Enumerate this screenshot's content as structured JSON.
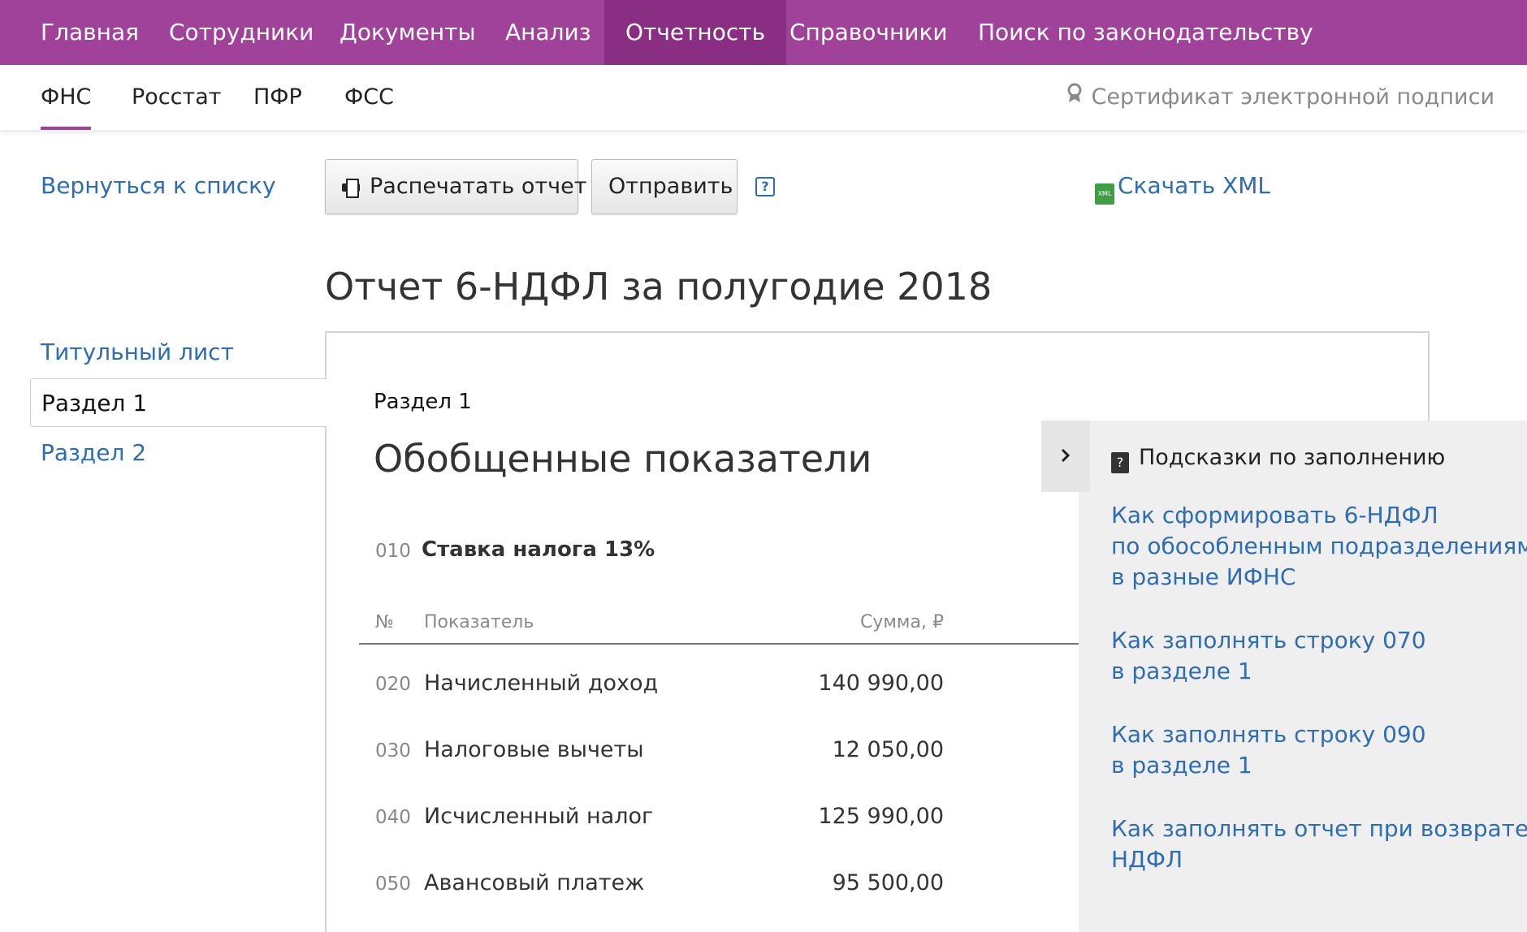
{
  "topnav": {
    "items": [
      "Главная",
      "Сотрудники",
      "Документы",
      "Анализ",
      "Отчетность",
      "Справочники",
      "Поиск по законодательству"
    ],
    "active": "Отчетность"
  },
  "subnav": {
    "items": [
      "ФНС",
      "Росстат",
      "ПФР",
      "ФСС"
    ],
    "active": "ФНС",
    "certificate": "Сертификат электронной подписи"
  },
  "toolbar": {
    "back": "Вернуться к списку",
    "print": "Распечатать отчет",
    "send": "Отправить",
    "help": "?",
    "xml_icon": "XML",
    "download_xml": "Скачать XML"
  },
  "report": {
    "title": "Отчет 6-НДФЛ за полугодие 2018"
  },
  "sidebar": {
    "items": [
      "Титульный лист",
      "Раздел 1",
      "Раздел 2"
    ],
    "active": "Раздел 1"
  },
  "section": {
    "label": "Раздел 1",
    "title": "Обобщенные показатели",
    "rate_code": "010",
    "rate_text": "Ставка налога 13%"
  },
  "table": {
    "headers": [
      "№",
      "Показатель",
      "Сумма, ₽"
    ],
    "rows": [
      {
        "code": "020",
        "name": "Начисленный доход",
        "sum": "140 990,00"
      },
      {
        "code": "030",
        "name": "Налоговые вычеты",
        "sum": "12 050,00"
      },
      {
        "code": "040",
        "name": "Исчисленный налог",
        "sum": "125 990,00"
      },
      {
        "code": "050",
        "name": "Авансовый платеж",
        "sum": "95 500,00"
      }
    ]
  },
  "hints": {
    "title": "Подсказки по заполнению",
    "links": [
      {
        "lines": [
          "Как сформировать 6-НДФЛ",
          "по обособленным подразделениям",
          "в разные ИФНС"
        ]
      },
      {
        "lines": [
          "Как заполнять строку 070",
          "в разделе 1"
        ]
      },
      {
        "lines": [
          "Как заполнять строку 090",
          "в разделе 1"
        ]
      },
      {
        "lines": [
          "Как заполнять отчет при возврате",
          "НДФЛ"
        ]
      }
    ]
  },
  "icons": {
    "print": "printer-icon",
    "help": "help-icon",
    "xml": "xml-file-icon",
    "certificate": "certificate-icon",
    "hints": "help-book-icon",
    "collapse": "chevron-right-icon"
  },
  "colors": {
    "brand": "#a0429a",
    "brand_active": "#8a2e84",
    "link": "#2d6db5",
    "hints_bg": "#efefef"
  }
}
